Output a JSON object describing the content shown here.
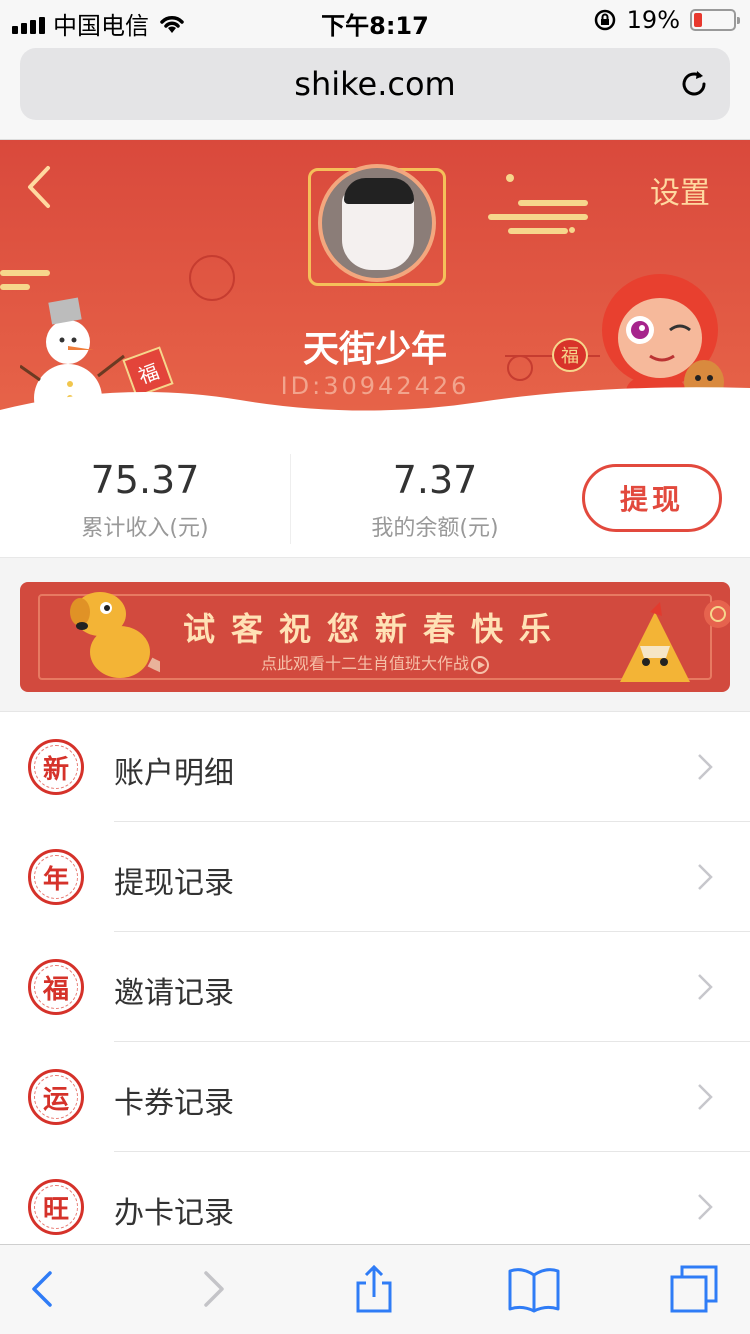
{
  "status_bar": {
    "carrier": "中国电信",
    "time": "下午8:17",
    "battery": "19%"
  },
  "browser": {
    "url": "shike.com"
  },
  "header": {
    "settings_label": "设置",
    "username": "天街少年",
    "user_id": "ID:30942426",
    "snowman_tag": "福",
    "mascot_lantern": "福"
  },
  "stats": {
    "total_income_value": "75.37",
    "total_income_label": "累计收入(元)",
    "balance_value": "7.37",
    "balance_label": "我的余额(元)",
    "withdraw_label": "提现"
  },
  "banner": {
    "title": "试客祝您新春快乐",
    "subtitle": "点此观看十二生肖值班大作战"
  },
  "menu": {
    "items": [
      {
        "seal": "新",
        "label": "账户明细"
      },
      {
        "seal": "年",
        "label": "提现记录"
      },
      {
        "seal": "福",
        "label": "邀请记录"
      },
      {
        "seal": "运",
        "label": "卡券记录"
      },
      {
        "seal": "旺",
        "label": "办卡记录"
      }
    ]
  },
  "colors": {
    "header_red": "#d9493c",
    "accent_red": "#e2493d",
    "gold": "#f6d68c",
    "ios_blue": "#2f7cf6"
  },
  "icons": {
    "status": [
      "signal-icon",
      "wifi-icon",
      "rotation-lock-icon",
      "battery-icon"
    ],
    "toolbar": [
      "back-icon",
      "forward-icon",
      "share-icon",
      "bookmarks-icon",
      "tabs-icon"
    ]
  }
}
